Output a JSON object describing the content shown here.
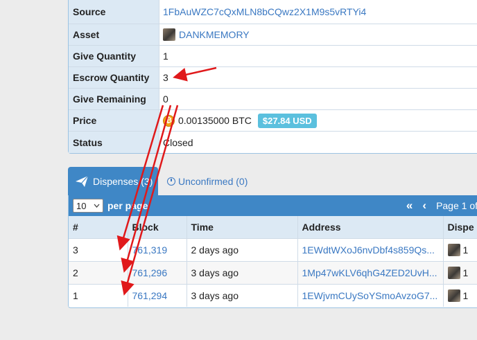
{
  "details": {
    "rows": [
      {
        "label": "Source",
        "value": "1FbAuWZC7cQxMLN8bCQwz2X1M9s5vRTYi4"
      },
      {
        "label": "Asset",
        "value": "DANKMEMORY"
      },
      {
        "label": "Give Quantity",
        "value": "1"
      },
      {
        "label": "Escrow Quantity",
        "value": "3"
      },
      {
        "label": "Give Remaining",
        "value": "0"
      },
      {
        "label": "Price",
        "value": "0.00135000 BTC",
        "badge": "$27.84 USD"
      },
      {
        "label": "Status",
        "value": "Closed"
      }
    ],
    "btc_glyph": "₿"
  },
  "tabs": {
    "active": "Dispenses (3)",
    "inactive": "Unconfirmed (0)"
  },
  "panel": {
    "per_page_value": "10",
    "per_page_label": "per page",
    "pager_first": "«",
    "pager_prev": "‹",
    "page_text": "Page 1 of"
  },
  "table": {
    "columns": [
      "#",
      "Block",
      "Time",
      "Address",
      "Dispe"
    ],
    "rows": [
      {
        "num": "3",
        "block": "761,319",
        "time": "2 days ago",
        "address": "1EWdtWXoJ6nvDbf4s859Qs...",
        "qty": "1"
      },
      {
        "num": "2",
        "block": "761,296",
        "time": "3 days ago",
        "address": "1Mp47wKLV6qhG4ZED2UvH...",
        "qty": "1"
      },
      {
        "num": "1",
        "block": "761,294",
        "time": "3 days ago",
        "address": "1EWjvmCUySoYSmoAvzoG7...",
        "qty": "1"
      }
    ]
  },
  "colors": {
    "accent": "#3f87c6",
    "label_bg": "#dce9f4",
    "badge": "#5bc0de",
    "annotation": "#e0191b"
  }
}
